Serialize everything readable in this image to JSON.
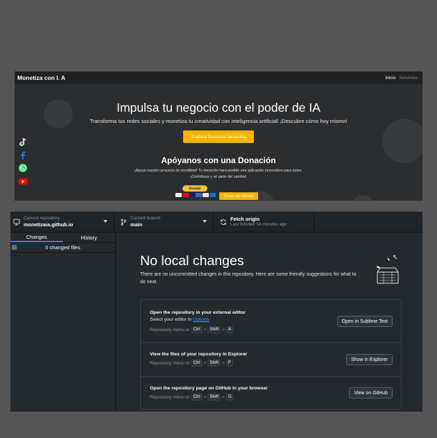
{
  "website": {
    "brand": "Monetiza con I. A",
    "nav": [
      "Inicio",
      "Servicios"
    ],
    "hero_title": "Impulsa tu negocio con el poder de IA",
    "hero_subtitle": "Transforma tus redes sociales y monetiza tu creatividad con inteligencia artificial! ¡Descubre cómo hoy mismo!",
    "hero_button": "Explora Nuestros Servicios",
    "social_icons": [
      "tiktok-icon",
      "facebook-icon",
      "whatsapp-icon",
      "youtube-icon"
    ],
    "donation_title": "Apóyanos con una Donación",
    "donation_text1": "¡Apoya nuestro proyecto de movilidad! Tu donación hará posible una aplicación innovadora para todos.",
    "donation_text2": "¡Contribuye y sé parte del cambio!",
    "paypal_button": "Donate",
    "wompi_button": "Donar con Wompi",
    "colors": {
      "accent": "#f4b400",
      "background": "#2b2d2f"
    }
  },
  "desktop": {
    "repo": {
      "label": "Current repository",
      "value": "monetizaia.github.io"
    },
    "branch": {
      "label": "Current branch",
      "value": "main"
    },
    "fetch": {
      "label": "Fetch origin",
      "status": "Last fetched 14 minutes ago"
    },
    "tabs": [
      "Changes",
      "History"
    ],
    "changed_files": "0 changed files",
    "heading": "No local changes",
    "description": "There are no uncommitted changes in this repository. Here are some friendly suggestions for what to do next.",
    "suggestions": [
      {
        "title": "Open the repository in your external editor",
        "subtitle_prefix": "Select your editor in ",
        "subtitle_link": "Options",
        "shortcut_prefix": "Repository menu or",
        "keys": [
          "Ctrl",
          "Shift",
          "A"
        ],
        "button": "Open in Sublime Text"
      },
      {
        "title": "View the files of your repository in Explorer",
        "shortcut_prefix": "Repository menu or",
        "keys": [
          "Ctrl",
          "Shift",
          "F"
        ],
        "button": "Show in Explorer"
      },
      {
        "title": "Open the repository page on GitHub in your browser",
        "shortcut_prefix": "Repository menu or",
        "keys": [
          "Ctrl",
          "Shift",
          "G"
        ],
        "button": "View on GitHub"
      }
    ],
    "colors": {
      "accent": "#2f81f7",
      "background": "#24292e"
    }
  }
}
